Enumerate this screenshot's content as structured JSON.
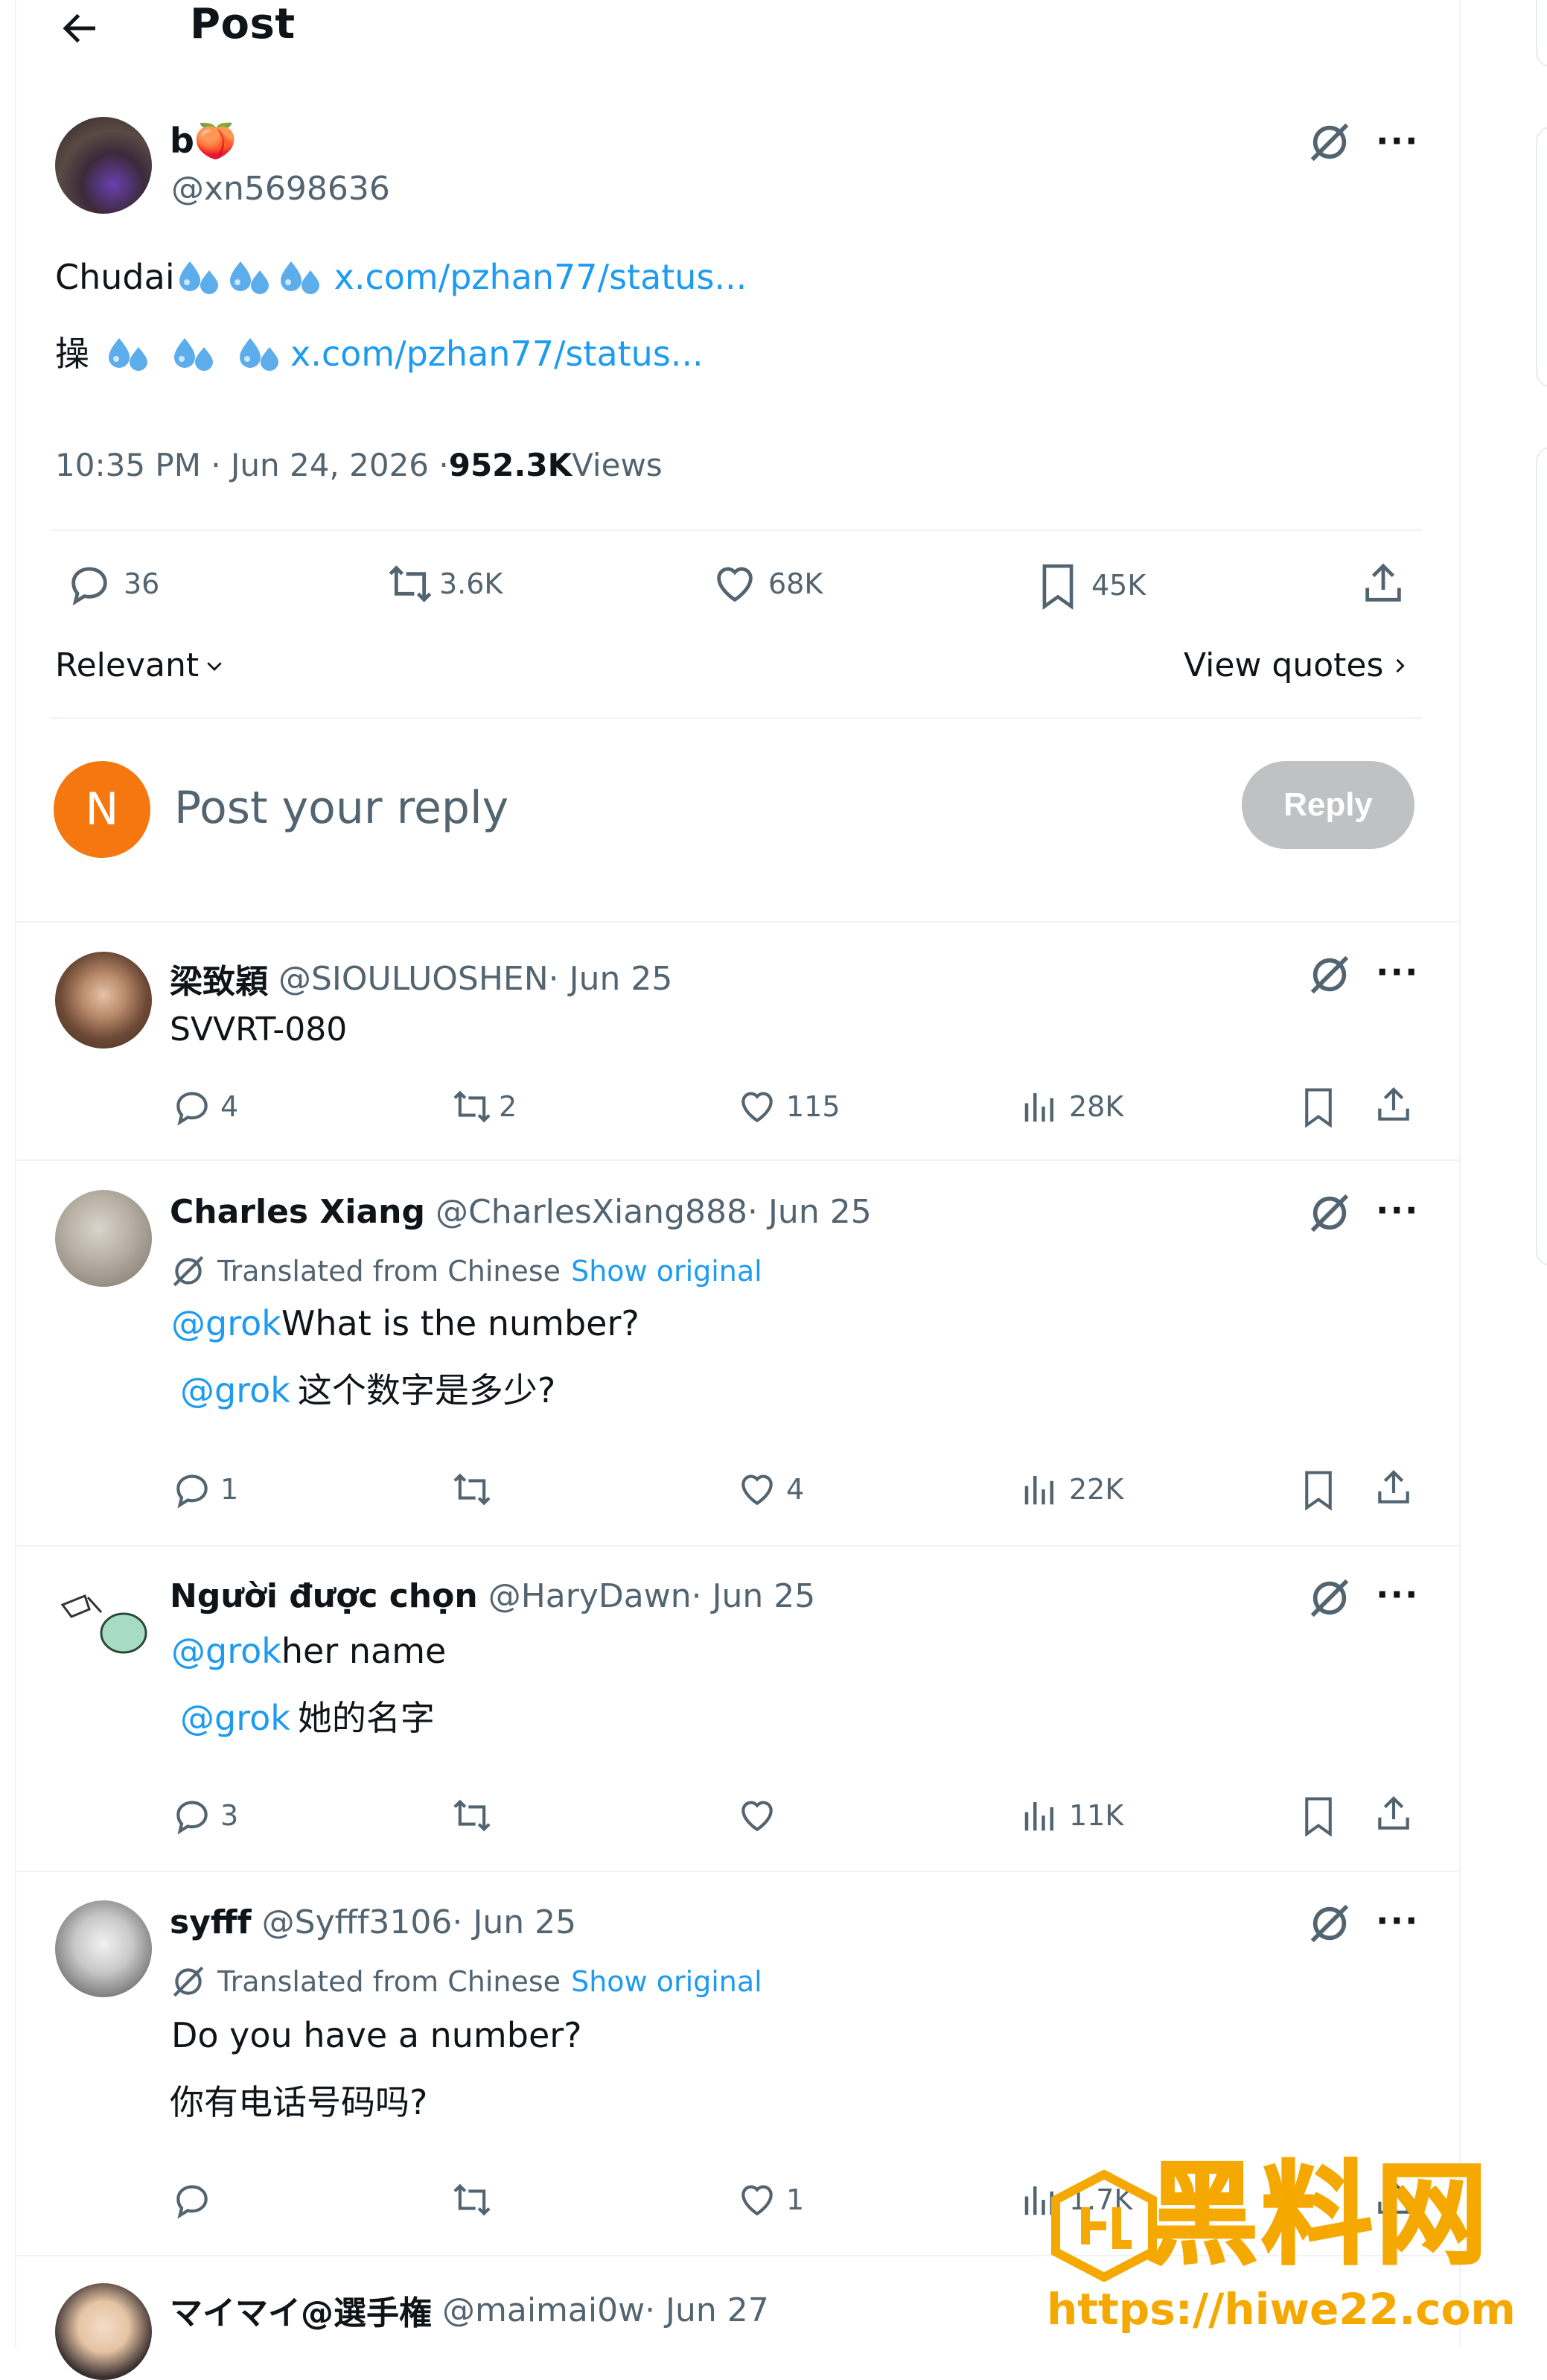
{
  "header": {
    "title": "Post"
  },
  "main_post": {
    "display_name": "b🍑",
    "handle": "@xn5698636",
    "line1_text": "Chudai",
    "line1_link": "x.com/pzhan77/status...",
    "line2_text": "操",
    "line2_link": "x.com/pzhan77/status...",
    "time": "10:35 PM · Jun 24, 2026 · ",
    "views_count": "952.3K",
    "views_label": " Views",
    "stats": {
      "replies": "36",
      "reposts": "3.6K",
      "likes": "68K",
      "bookmarks": "45K"
    },
    "sort_label": "Relevant",
    "view_quotes_label": "View quotes"
  },
  "composer": {
    "avatar_letter": "N",
    "placeholder": "Post your reply",
    "reply_label": "Reply"
  },
  "replies": [
    {
      "name": "梁致穎",
      "handle": "@SIOULUOSHEN",
      "date": " · Jun 25",
      "text": "SVVRT-080",
      "replies": "4",
      "reposts": "2",
      "likes": "115",
      "views": "28K"
    },
    {
      "name": "Charles Xiang",
      "handle": "@CharlesXiang888",
      "date": " · Jun 25",
      "translated_label": "Translated from Chinese",
      "show_original": "Show original",
      "mention": "@grok",
      "text": " What is the number?",
      "orig_mention": "@grok",
      "orig_text": " 这个数字是多少?",
      "replies": "1",
      "likes": "4",
      "views": "22K"
    },
    {
      "name": "Người được chọn",
      "handle": "@HaryDawn",
      "date": " · Jun 25",
      "mention": "@grok",
      "text": " her name",
      "orig_mention": "@grok",
      "orig_text": " 她的名字",
      "replies": "3",
      "views": "11K"
    },
    {
      "name": "syfff",
      "handle": "@Syfff3106",
      "date": " · Jun 25",
      "translated_label": "Translated from Chinese",
      "show_original": "Show original",
      "text": "Do you have a number?",
      "orig_text": "你有电话号码吗?",
      "likes": "1",
      "views": "1.7K"
    },
    {
      "name": "マイマイ@選手権",
      "handle": "@maimai0w",
      "date": " · Jun 27"
    }
  ],
  "watermark": {
    "brand": "黑料网",
    "url": "https://hiwe22.com"
  },
  "colors": {
    "link": "#1d9bf0",
    "muted": "#536471",
    "composer_avatar": "#f4780f",
    "watermark": "#f5a800"
  }
}
